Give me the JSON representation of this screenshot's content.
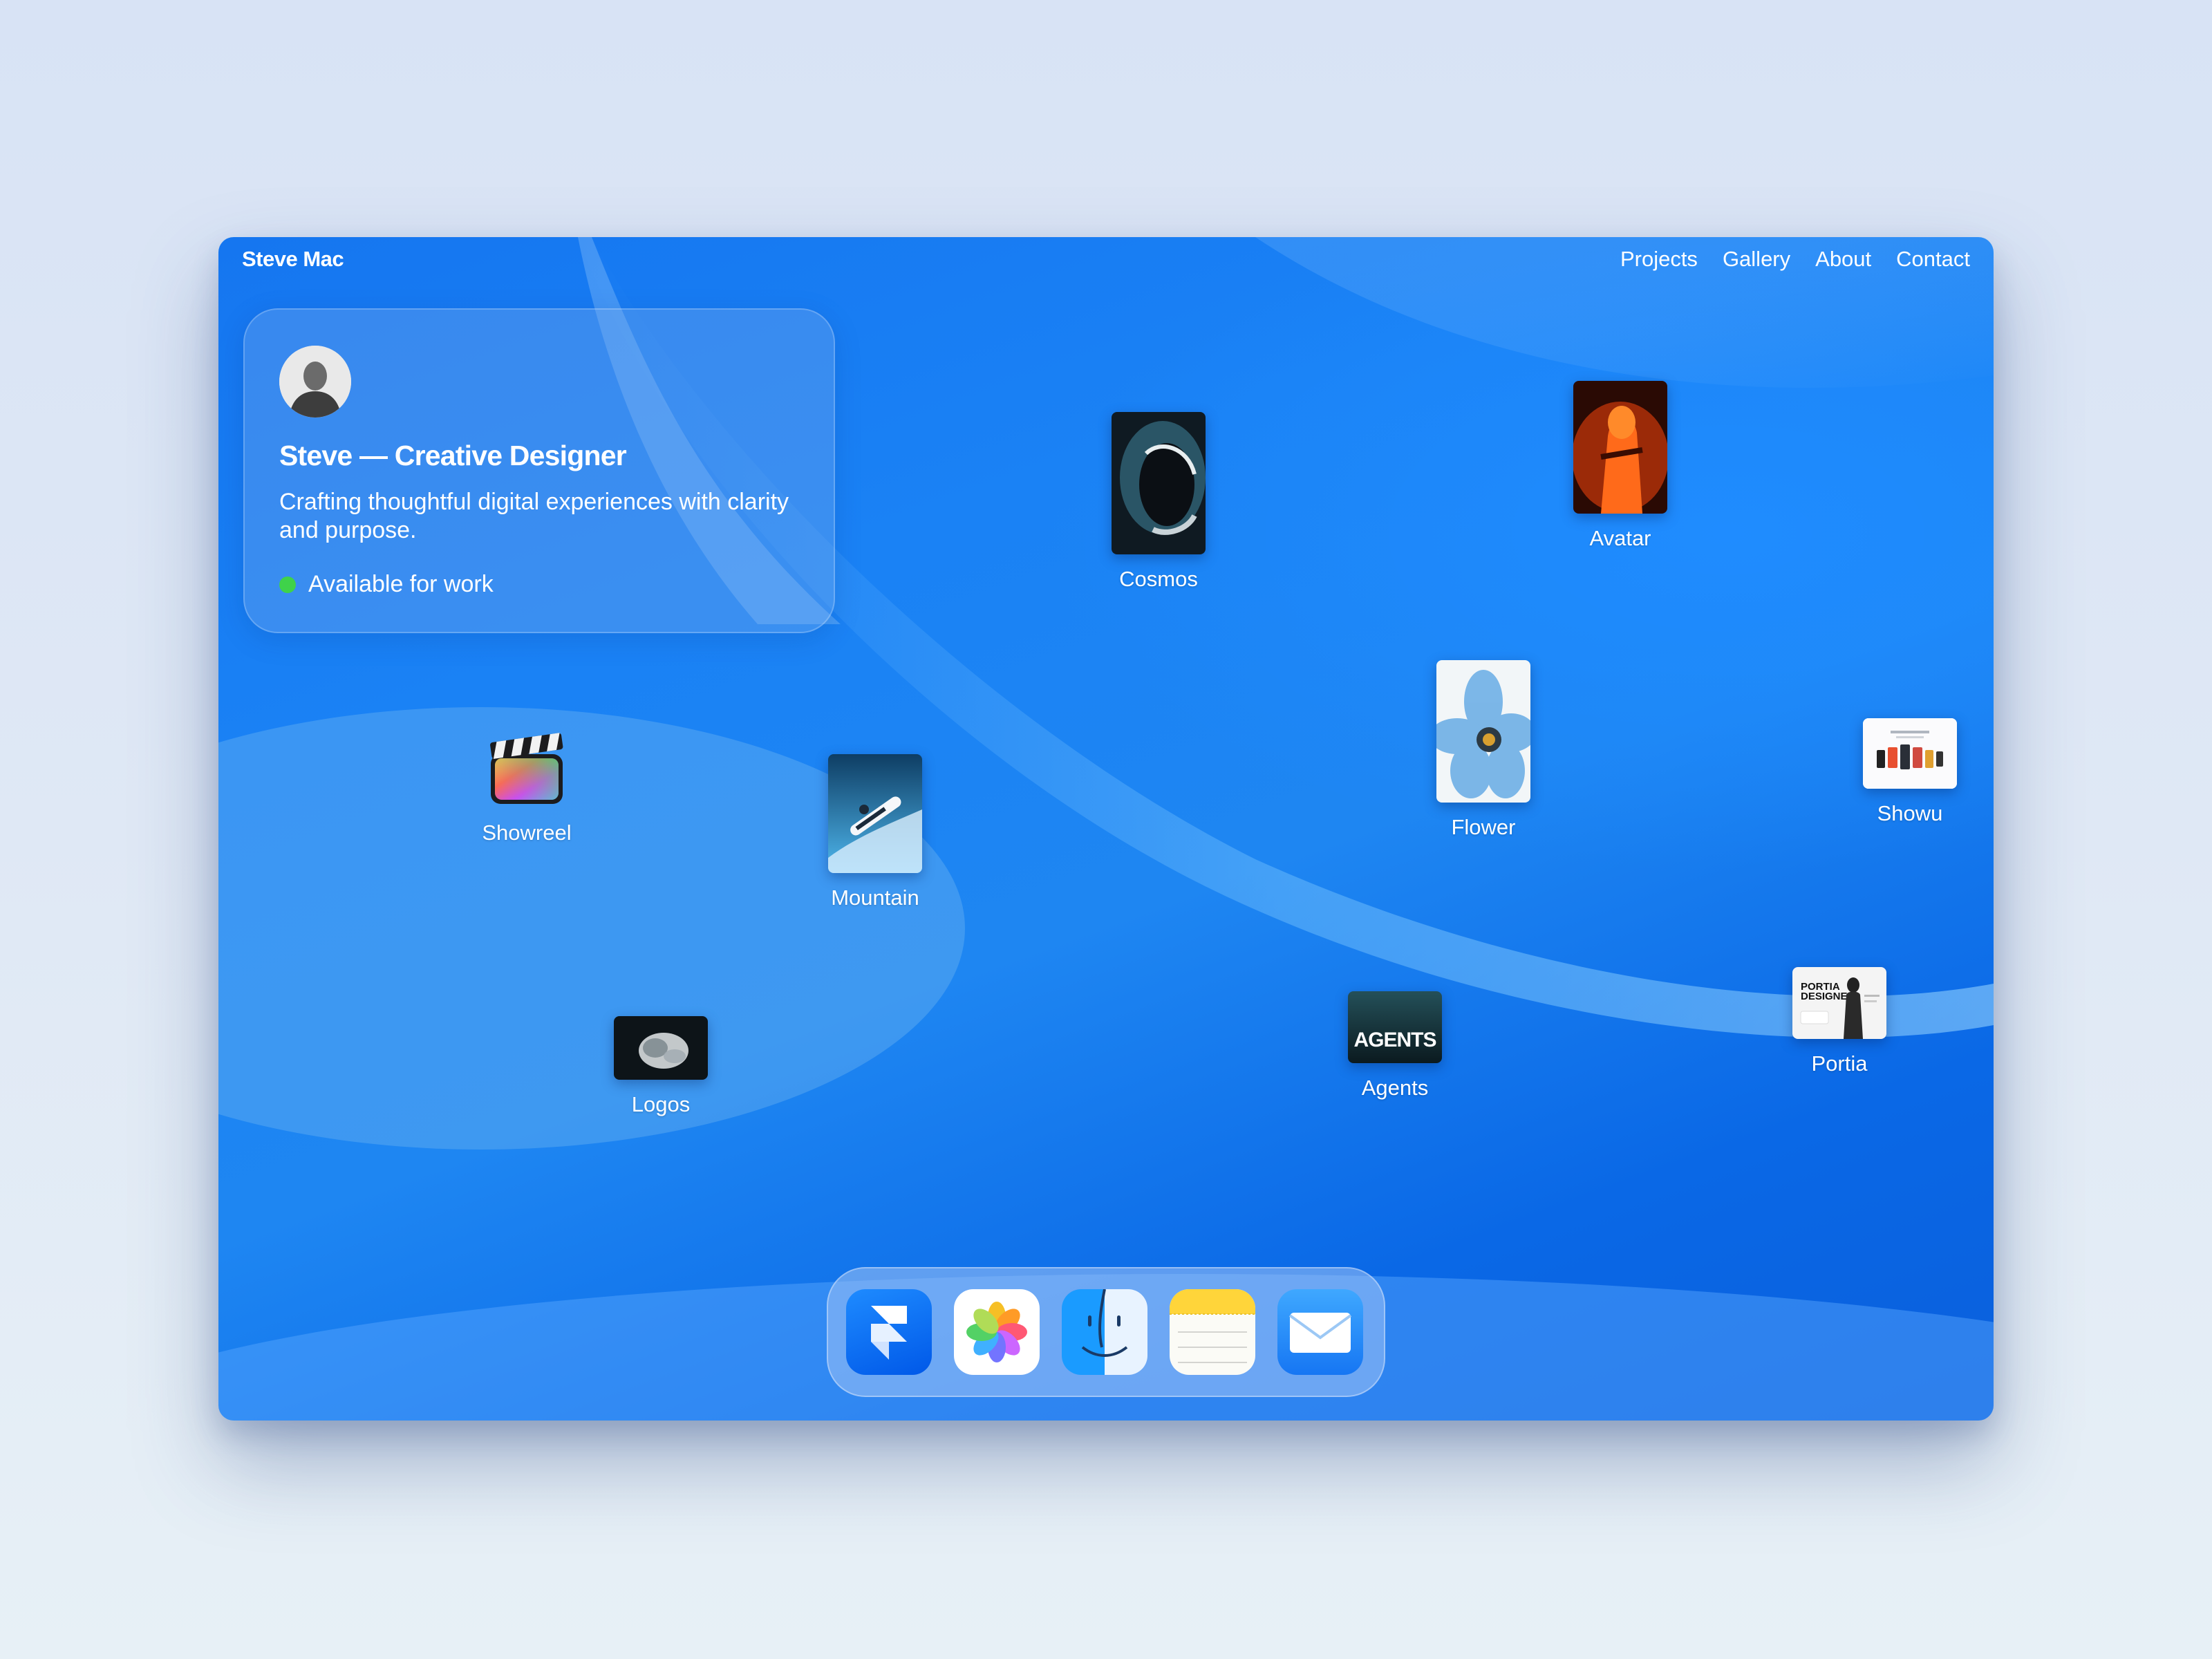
{
  "topbar": {
    "brand": "Steve Mac",
    "nav": [
      "Projects",
      "Gallery",
      "About",
      "Contact"
    ]
  },
  "profile": {
    "title": "Steve — Creative Designer",
    "description": "Crafting thoughtful digital experiences with clarity and purpose.",
    "status": "Available for work",
    "status_color": "#3fd24a"
  },
  "desktop_items": [
    {
      "label": "Cosmos",
      "icon": "astronaut-helmet-thumbnail"
    },
    {
      "label": "Avatar",
      "icon": "orange-figure-thumbnail"
    },
    {
      "label": "Flower",
      "icon": "blue-flower-thumbnail"
    },
    {
      "label": "Showu",
      "icon": "app-screens-thumbnail"
    },
    {
      "label": "Showreel",
      "icon": "clapperboard-icon"
    },
    {
      "label": "Mountain",
      "icon": "mountain-snowboard-thumbnail"
    },
    {
      "label": "Logos",
      "icon": "logos-thumbnail"
    },
    {
      "label": "Agents",
      "icon": "agents-thumbnail",
      "thumb_text": "AGENTS"
    },
    {
      "label": "Portia",
      "icon": "portia-designer-thumbnail",
      "thumb_text": "PORTIA DESIGNER"
    }
  ],
  "dock": [
    {
      "icon": "framer-icon"
    },
    {
      "icon": "photos-icon"
    },
    {
      "icon": "finder-icon"
    },
    {
      "icon": "notes-icon"
    },
    {
      "icon": "mail-icon"
    }
  ],
  "colors": {
    "window_blue": "#1a82f5",
    "page_background": "#dfe8f5",
    "dock_glass": "#a0c3f5"
  }
}
